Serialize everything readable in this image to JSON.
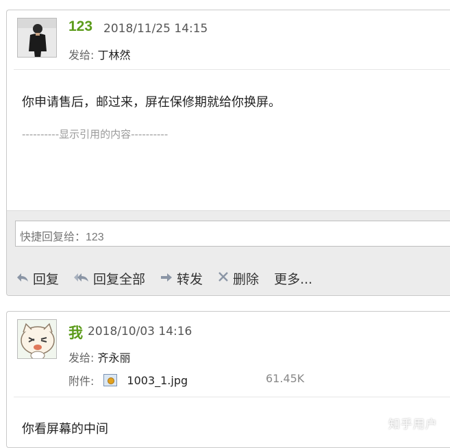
{
  "messages": [
    {
      "sender": "123",
      "datetime": "2018/11/25 14:15",
      "to_label": "发给:",
      "to_name": "丁林然",
      "body": "你申请售后，邮过来，屏在保修期就给你换屏。",
      "quote": "----------显示引用的内容----------"
    },
    {
      "sender": "我",
      "datetime": "2018/10/03 14:16",
      "to_label": "发给:",
      "to_name": "齐永丽",
      "attachment_label": "附件:",
      "attachment_name": "1003_1.jpg",
      "attachment_size": "61.45K",
      "body": "你看屏幕的中间"
    }
  ],
  "quick_reply": {
    "placeholder": "快捷回复给：123"
  },
  "toolbar": {
    "reply": "回复",
    "reply_all": "回复全部",
    "forward": "转发",
    "delete": "删除",
    "more": "更多..."
  },
  "icons": {
    "reply": "reply-arrow-icon",
    "reply_all": "reply-all-icon",
    "forward": "forward-arrow-icon",
    "delete": "delete-x-icon",
    "attachment": "image-file-icon"
  },
  "colors": {
    "sender_name": "#5b9b1a",
    "toolbar_bg": "#ececec",
    "quote_text": "#9a9a9a"
  },
  "watermark": "知乎用户"
}
